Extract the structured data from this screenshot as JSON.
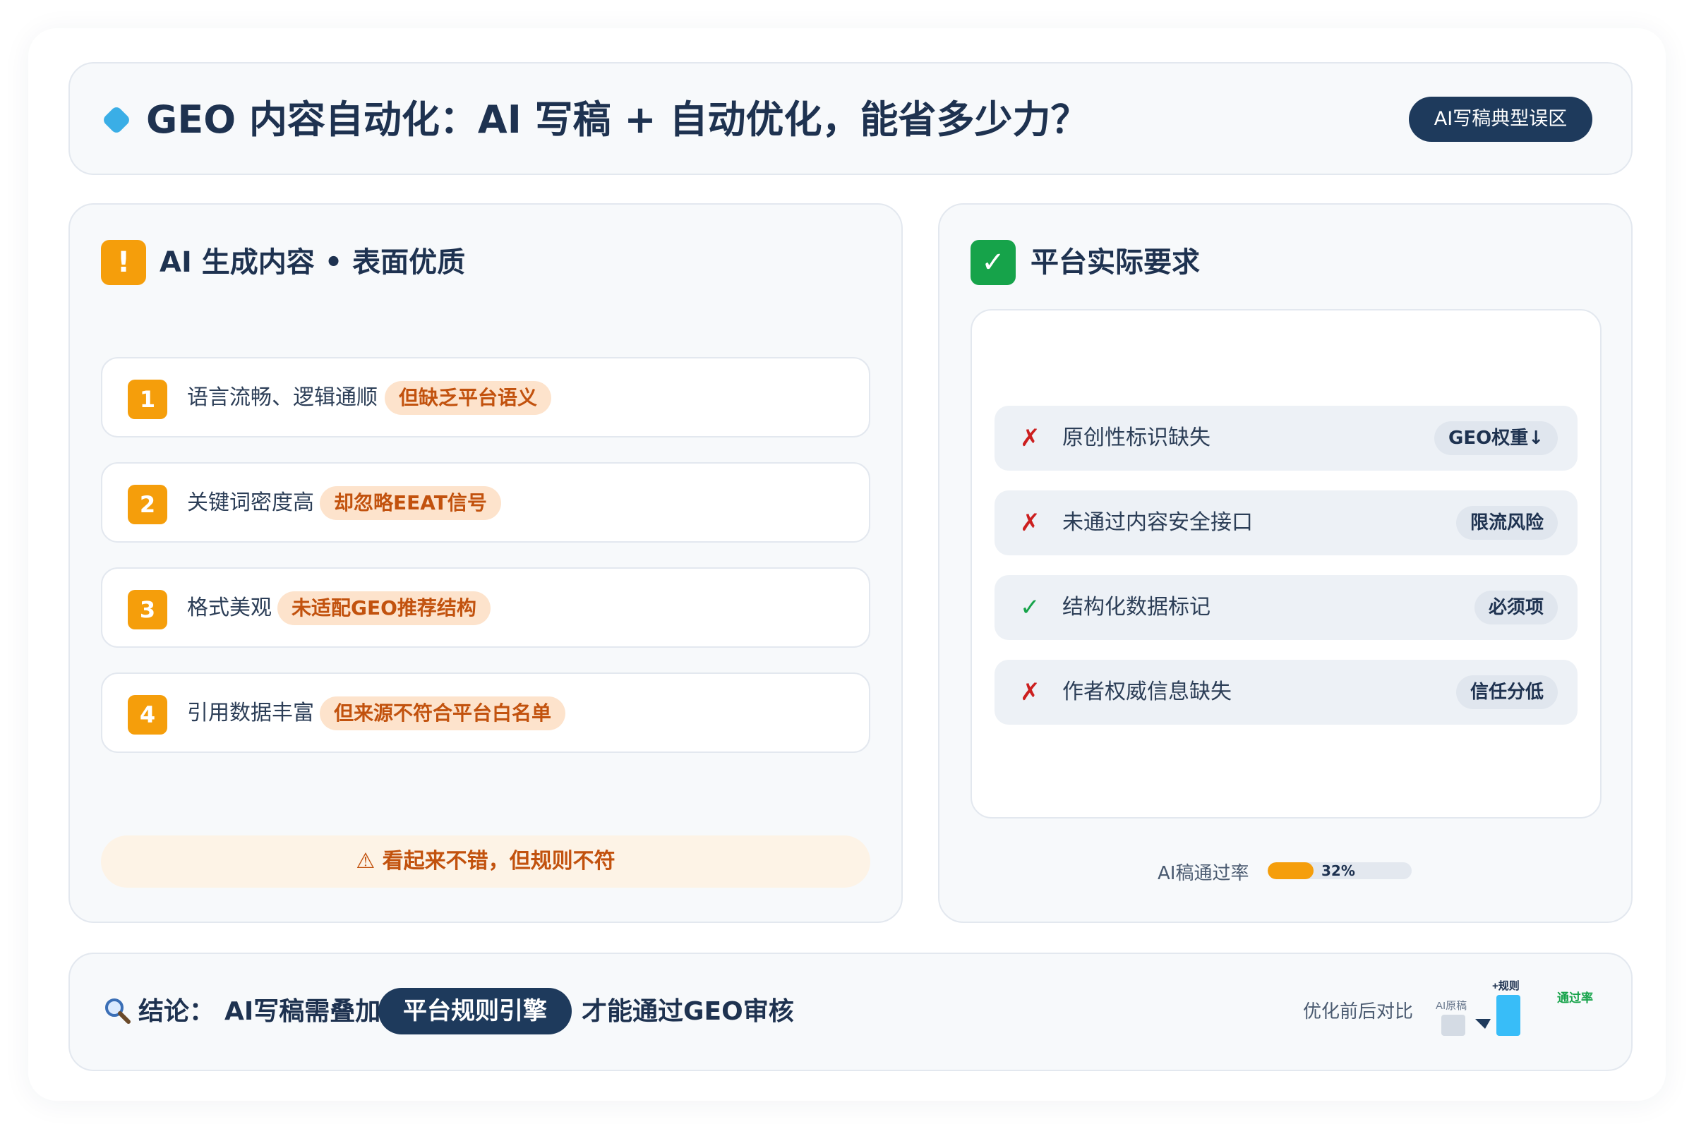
{
  "header": {
    "title": "GEO 内容自动化：AI 写稿 + 自动优化，能省多少力？",
    "pill": "AI写稿典型误区"
  },
  "left_panel": {
    "badge": "!",
    "title": "AI 生成内容 • 表面优质",
    "items": [
      {
        "num": "1",
        "text": "语言流畅、逻辑通顺",
        "tag": "但缺乏平台语义"
      },
      {
        "num": "2",
        "text": "关键词密度高",
        "tag": "却忽略EEAT信号"
      },
      {
        "num": "3",
        "text": "格式美观",
        "tag": "未适配GEO推荐结构"
      },
      {
        "num": "4",
        "text": "引用数据丰富",
        "tag": "但来源不符合平台白名单"
      }
    ],
    "warning": "⚠ 看起来不错，但规则不符"
  },
  "right_panel": {
    "badge": "✓",
    "title": "平台实际要求",
    "requirements": [
      {
        "mark": "✗",
        "status": "fail",
        "text": "原创性标识缺失",
        "tag": "GEO权重↓"
      },
      {
        "mark": "✗",
        "status": "fail",
        "text": "未通过内容安全接口",
        "tag": "限流风险"
      },
      {
        "mark": "✓",
        "status": "pass",
        "text": "结构化数据标记",
        "tag": "必须项"
      },
      {
        "mark": "✗",
        "status": "fail",
        "text": "作者权威信息缺失",
        "tag": "信任分低"
      }
    ],
    "pass_rate": {
      "label": "AI稿通过率",
      "value_text": "32%",
      "value": 0.32
    }
  },
  "conclusion": {
    "icon": "search-icon",
    "label": "结论：",
    "prefix": "AI写稿需叠加",
    "highlight": "平台规则引擎",
    "suffix": "才能通过GEO审核"
  },
  "comparison": {
    "label": "优化前后对比",
    "before_label": "AI原稿",
    "after_label": "+规则",
    "metric_label": "通过率"
  },
  "colors": {
    "accent_orange": "#f59e0b",
    "accent_green": "#16a34a",
    "fail_red": "#cc1f1f",
    "navy": "#1e3a5c",
    "sky": "#38bdf8"
  }
}
